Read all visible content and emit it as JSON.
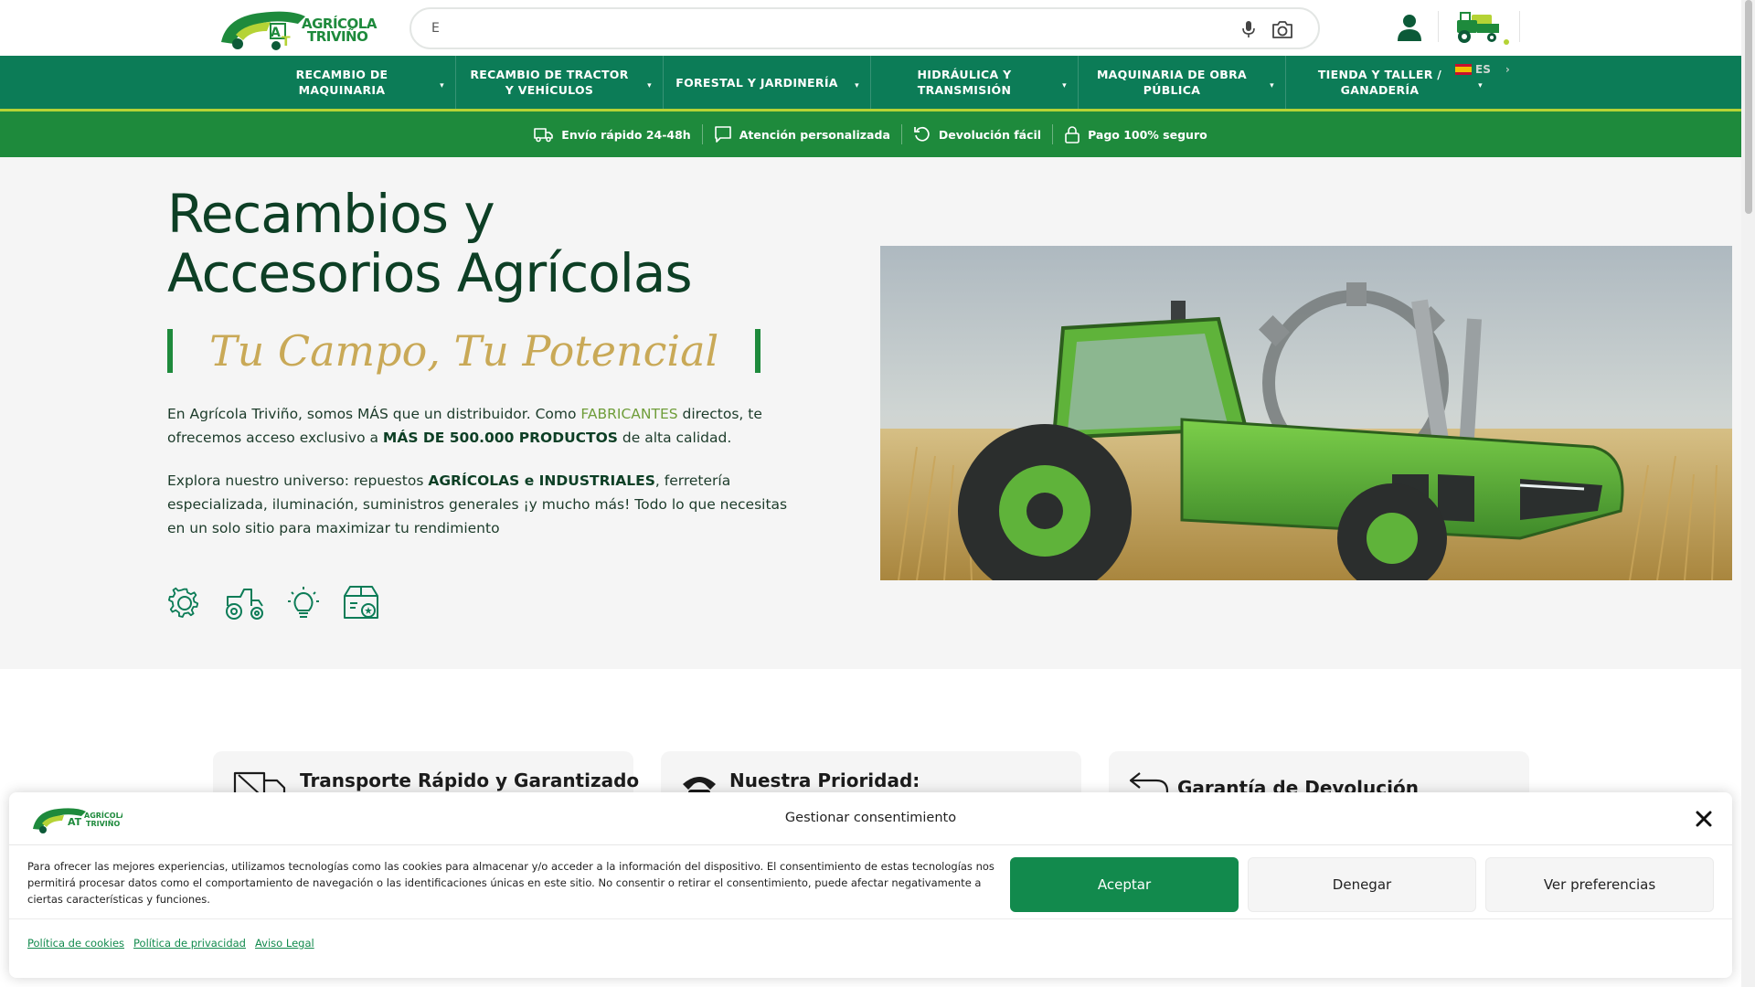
{
  "header": {
    "logo_line1": "AGRÍCOLA",
    "logo_line2": "TRIVIÑO",
    "search_value": "E",
    "search_placeholder": ""
  },
  "nav": {
    "items": [
      {
        "label": "RECAMBIO DE MAQUINARIA",
        "caret": "▾"
      },
      {
        "label": "RECAMBIO DE TRACTOR Y VEHÍCULOS",
        "caret": "▾"
      },
      {
        "label": "FORESTAL Y JARDINERÍA",
        "caret": "▾"
      },
      {
        "label": "HIDRÁULICA Y TRANSMISIÓN",
        "caret": "▾"
      },
      {
        "label": "MAQUINARIA DE OBRA PÚBLICA",
        "caret": "▾"
      },
      {
        "label": "TIENDA Y TALLER / GANADERÍA",
        "caret": "▾"
      }
    ],
    "language": "ES"
  },
  "benefits": [
    {
      "label": "Envío rápido 24-48h",
      "icon": "truck-icon"
    },
    {
      "label": "Atención personalizada",
      "icon": "chat-icon"
    },
    {
      "label": "Devolución fácil",
      "icon": "return-icon"
    },
    {
      "label": "Pago 100% seguro",
      "icon": "lock-icon"
    }
  ],
  "hero": {
    "title_line1": "Recambios y",
    "title_line2": "Accesorios Agrícolas",
    "slogan": "Tu Campo, Tu Potencial",
    "p1_a": "En Agrícola Triviño, somos MÁS que un distribuidor. Como ",
    "p1_hl": "FABRICANTES",
    "p1_b": " directos, te ofrecemos acceso exclusivo a ",
    "p1_bold": "MÁS DE 500.000 PRODUCTOS",
    "p1_c": " de alta calidad.",
    "p2_a": "Explora nuestro universo: repuestos ",
    "p2_bold": "AGRÍCOLAS e INDUSTRIALES",
    "p2_b": ", ferretería especializada, iluminación, suministros generales ¡y mucho más! Todo lo que necesitas en un solo sitio para maximizar tu rendimiento"
  },
  "features": [
    {
      "title": "Transporte Rápido y Garantizado",
      "icon": "truck-icon"
    },
    {
      "title": "Nuestra Prioridad:",
      "icon": "phone-icon"
    },
    {
      "title": "Garantía de Devolución",
      "icon": "return-arrow-icon"
    }
  ],
  "cookie": {
    "title": "Gestionar consentimiento",
    "text": "Para ofrecer las mejores experiencias, utilizamos tecnologías como las cookies para almacenar y/o acceder a la información del dispositivo. El consentimiento de estas tecnologías nos permitirá procesar datos como el comportamiento de navegación o las identificaciones únicas en este sitio. No consentir o retirar el consentimiento, puede afectar negativamente a ciertas características y funciones.",
    "accept": "Aceptar",
    "deny": "Denegar",
    "prefs": "Ver preferencias",
    "links": [
      "Política de cookies",
      "Política de privacidad",
      "Aviso Legal"
    ]
  },
  "colors": {
    "brand_green": "#0c7c57",
    "accent_green": "#1e8a3c",
    "lime": "#b5d335",
    "gold": "#c9a957",
    "dark_green": "#0d3f25"
  }
}
